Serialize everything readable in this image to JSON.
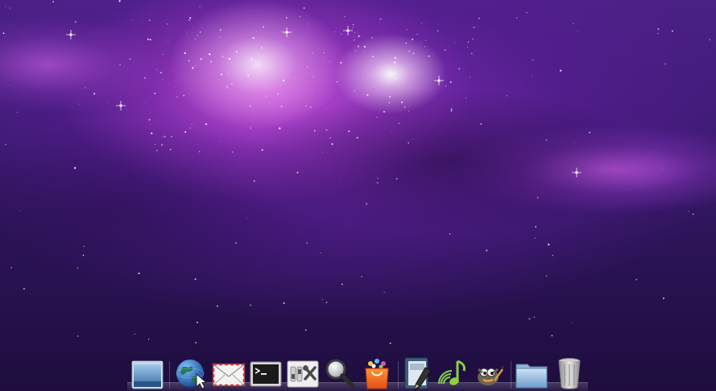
{
  "desktop": {
    "wallpaper": "purple-nebula-galaxy",
    "colors": {
      "nebula_core": "#f6e4ff",
      "nebula_mid": "#c85ee0",
      "space": "#2c1458"
    }
  },
  "dock": {
    "items": [
      {
        "name": "desktop-preview-icon",
        "icon": "window-desktop"
      },
      {
        "name": "web-browser-icon",
        "icon": "globe-with-cursor"
      },
      {
        "name": "mail-icon",
        "icon": "envelope"
      },
      {
        "name": "terminal-icon",
        "icon": "terminal-prompt"
      },
      {
        "name": "system-settings-icon",
        "icon": "switches-and-tools"
      },
      {
        "name": "search-icon",
        "icon": "magnifying-glass"
      },
      {
        "name": "software-store-icon",
        "icon": "shopping-bag"
      },
      {
        "name": "text-editor-icon",
        "icon": "notebook-and-pen"
      },
      {
        "name": "music-player-icon",
        "icon": "music-note-wifi"
      },
      {
        "name": "image-editor-icon",
        "icon": "gimp-wilber"
      },
      {
        "name": "file-manager-icon",
        "icon": "folder"
      },
      {
        "name": "trash-icon",
        "icon": "trash-can"
      }
    ]
  }
}
